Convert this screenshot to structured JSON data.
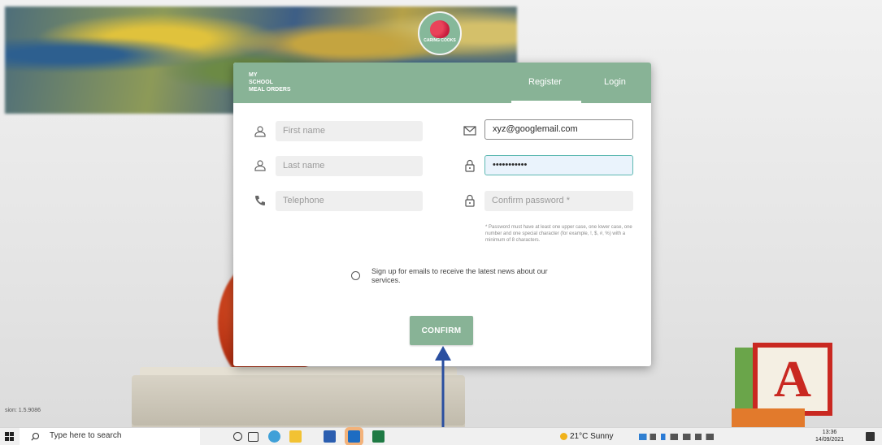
{
  "app": {
    "brand_lines": [
      "MY",
      "SCHOOL",
      "MEAL ORDERS"
    ],
    "logo_text": "CARING COOKS"
  },
  "tabs": [
    {
      "label": "Register",
      "active": true
    },
    {
      "label": "Login",
      "active": false
    }
  ],
  "form": {
    "first_name": {
      "placeholder": "First name",
      "value": ""
    },
    "last_name": {
      "placeholder": "Last name",
      "value": ""
    },
    "telephone": {
      "placeholder": "Telephone",
      "value": ""
    },
    "email": {
      "value": "xyz@googlemail.com"
    },
    "password": {
      "value": "•••••••••••"
    },
    "confirm_password": {
      "placeholder": "Confirm password *",
      "value": ""
    },
    "password_hint": "* Password must have at least one upper case, one lower case, one number and one special character (for example, !, $, #, %) with a minimum of 8 characters.",
    "optin_label": "Sign up for emails to receive the latest news about our services.",
    "optin_checked": false,
    "confirm_label": "CONFIRM"
  },
  "version_text": "sion: 1.5.9086",
  "taskbar": {
    "search_placeholder": "Type here to search",
    "weather": "21°C  Sunny",
    "time": "13:36",
    "date": "14/09/2021"
  },
  "colors": {
    "accent": "#88b396",
    "focus_border": "#5fb9b2",
    "annotation_arrow": "#2a4fa0"
  },
  "icons": [
    "person-icon",
    "phone-icon",
    "envelope-icon",
    "lock-icon",
    "windows-icon",
    "search-icon"
  ]
}
